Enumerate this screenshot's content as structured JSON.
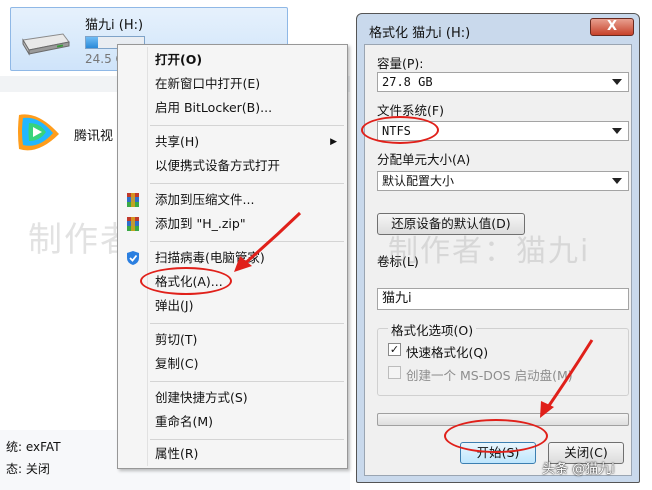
{
  "explorer": {
    "drive_name": "猫九i (H:)",
    "drive_free": "24.5 G",
    "drive_usage_fraction": 0.2,
    "app_label": "腾讯视",
    "status_fs": "统: exFAT",
    "status_state": "态: 关闭"
  },
  "watermark": {
    "left_text": "制作者：猫九i",
    "right_text": "制作者：猫九i"
  },
  "context_menu": {
    "items": [
      {
        "label": "打开(O)",
        "bold": true
      },
      {
        "label": "在新窗口中打开(E)"
      },
      {
        "label": "启用 BitLocker(B)..."
      },
      {
        "label": "共享(H)",
        "submenu": true
      },
      {
        "label": "以便携式设备方式打开"
      },
      {
        "label": "添加到压缩文件...",
        "icon": "winrar-icon"
      },
      {
        "label": "添加到 \"H_.zip\"",
        "icon": "winrar-icon"
      },
      {
        "label": "扫描病毒(电脑管家)",
        "icon": "tencent-shield-icon"
      },
      {
        "label": "格式化(A)...",
        "highlighted": true
      },
      {
        "label": "弹出(J)"
      },
      {
        "label": "剪切(T)"
      },
      {
        "label": "复制(C)"
      },
      {
        "label": "创建快捷方式(S)"
      },
      {
        "label": "重命名(M)"
      },
      {
        "label": "属性(R)"
      }
    ],
    "submenu_arrow": "▶"
  },
  "format_dialog": {
    "title": "格式化 猫九i (H:)",
    "close_glyph": "X",
    "capacity_label": "容量(P):",
    "capacity_value": "27.8 GB",
    "filesystem_label": "文件系统(F)",
    "filesystem_value": "NTFS",
    "allocation_label": "分配单元大小(A)",
    "allocation_value": "默认配置大小",
    "restore_defaults_button": "还原设备的默认值(D)",
    "volume_label_label": "卷标(L)",
    "volume_label_value": "猫九i",
    "options_legend": "格式化选项(O)",
    "quick_format_label": "快速格式化(Q)",
    "quick_format_checked": true,
    "msdos_label": "创建一个 MS-DOS 启动盘(M)",
    "msdos_checked": false,
    "start_button": "开始(S)",
    "close_button": "关闭(C)",
    "checkmark": "✓"
  },
  "footer": {
    "source_mark": "头条 @猫九i"
  },
  "colors": {
    "annotation_red": "#e0201a",
    "dialog_frame": "#c9d9ec",
    "selection_blue": "#cfe4fa"
  }
}
